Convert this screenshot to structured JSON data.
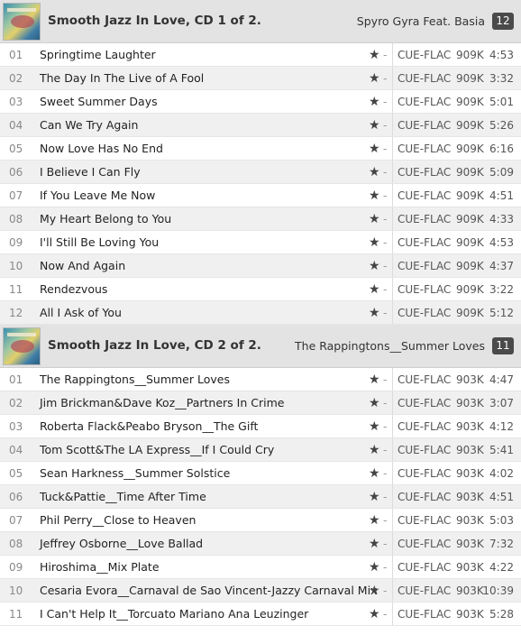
{
  "albums": [
    {
      "title": "Smooth Jazz In Love, CD 1 of 2.",
      "artist": "Spyro Gyra Feat. Basia",
      "count": "12",
      "tracks": [
        {
          "num": "01",
          "title": "Springtime Laughter",
          "format": "CUE-FLAC",
          "bitrate": "909K",
          "duration": "4:53"
        },
        {
          "num": "02",
          "title": "The Day In The Live of A Fool",
          "format": "CUE-FLAC",
          "bitrate": "909K",
          "duration": "3:32"
        },
        {
          "num": "03",
          "title": "Sweet Summer Days",
          "format": "CUE-FLAC",
          "bitrate": "909K",
          "duration": "5:01"
        },
        {
          "num": "04",
          "title": "Can We Try Again",
          "format": "CUE-FLAC",
          "bitrate": "909K",
          "duration": "5:26"
        },
        {
          "num": "05",
          "title": "Now Love Has No End",
          "format": "CUE-FLAC",
          "bitrate": "909K",
          "duration": "6:16"
        },
        {
          "num": "06",
          "title": "I Believe I Can Fly",
          "format": "CUE-FLAC",
          "bitrate": "909K",
          "duration": "5:09"
        },
        {
          "num": "07",
          "title": "If You Leave Me Now",
          "format": "CUE-FLAC",
          "bitrate": "909K",
          "duration": "4:51"
        },
        {
          "num": "08",
          "title": "My Heart Belong to You",
          "format": "CUE-FLAC",
          "bitrate": "909K",
          "duration": "4:33"
        },
        {
          "num": "09",
          "title": "I'll Still Be Loving You",
          "format": "CUE-FLAC",
          "bitrate": "909K",
          "duration": "4:53"
        },
        {
          "num": "10",
          "title": "Now And Again",
          "format": "CUE-FLAC",
          "bitrate": "909K",
          "duration": "4:37"
        },
        {
          "num": "11",
          "title": "Rendezvous",
          "format": "CUE-FLAC",
          "bitrate": "909K",
          "duration": "3:22"
        },
        {
          "num": "12",
          "title": "All I Ask of You",
          "format": "CUE-FLAC",
          "bitrate": "909K",
          "duration": "5:12"
        }
      ]
    },
    {
      "title": "Smooth Jazz In Love, CD 2 of 2.",
      "artist": "The Rappingtons__Summer Loves",
      "count": "11",
      "tracks": [
        {
          "num": "01",
          "title": "The Rappingtons__Summer Loves",
          "format": "CUE-FLAC",
          "bitrate": "903K",
          "duration": "4:47"
        },
        {
          "num": "02",
          "title": "Jim Brickman&Dave Koz__Partners In Crime",
          "format": "CUE-FLAC",
          "bitrate": "903K",
          "duration": "3:07"
        },
        {
          "num": "03",
          "title": "Roberta Flack&Peabo Bryson__The Gift",
          "format": "CUE-FLAC",
          "bitrate": "903K",
          "duration": "4:12"
        },
        {
          "num": "04",
          "title": "Tom Scott&The LA Express__If I Could Cry",
          "format": "CUE-FLAC",
          "bitrate": "903K",
          "duration": "5:41"
        },
        {
          "num": "05",
          "title": "Sean Harkness__Summer Solstice",
          "format": "CUE-FLAC",
          "bitrate": "903K",
          "duration": "4:02"
        },
        {
          "num": "06",
          "title": "Tuck&Pattie__Time After Time",
          "format": "CUE-FLAC",
          "bitrate": "903K",
          "duration": "4:51"
        },
        {
          "num": "07",
          "title": "Phil Perry__Close to Heaven",
          "format": "CUE-FLAC",
          "bitrate": "903K",
          "duration": "5:03"
        },
        {
          "num": "08",
          "title": "Jeffrey Osborne__Love Ballad",
          "format": "CUE-FLAC",
          "bitrate": "903K",
          "duration": "7:32"
        },
        {
          "num": "09",
          "title": "Hiroshima__Mix Plate",
          "format": "CUE-FLAC",
          "bitrate": "903K",
          "duration": "4:22"
        },
        {
          "num": "10",
          "title": "Cesaria Evora__Carnaval de Sao Vincent-Jazzy Carnaval Mix",
          "format": "CUE-FLAC",
          "bitrate": "903K",
          "duration": "10:39"
        },
        {
          "num": "11",
          "title": "I Can't Help It__Torcuato Mariano Ana Leuzinger",
          "format": "CUE-FLAC",
          "bitrate": "903K",
          "duration": "5:28"
        }
      ]
    }
  ],
  "icons": {
    "rating": "star-icon",
    "rating_glyph": "★",
    "rating_suffix": "-"
  }
}
